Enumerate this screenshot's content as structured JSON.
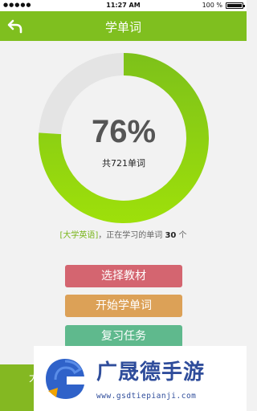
{
  "status_bar": {
    "signal": "●●●●●",
    "time": "11:27 AM",
    "battery_text": "100 %"
  },
  "header": {
    "title": "学单词",
    "back_icon": "back-arrow-icon"
  },
  "progress": {
    "percent_text": "76%",
    "value": 0.76,
    "total_text": "共721单词",
    "colors": {
      "progress": "#8fd00f",
      "track": "#e4e4e4"
    }
  },
  "learning": {
    "book": "[大学英语]",
    "middle": "，正在学习的单词 ",
    "count": "30",
    "suffix": " 个"
  },
  "buttons": {
    "choose_textbook": "选择教材",
    "start_learning": "开始学单词",
    "review_task": "复习任务"
  },
  "bottom_bar": {
    "label": "大"
  },
  "watermark": {
    "brand": "广晟德手游",
    "url": "www.gsdtiepianji.com"
  }
}
